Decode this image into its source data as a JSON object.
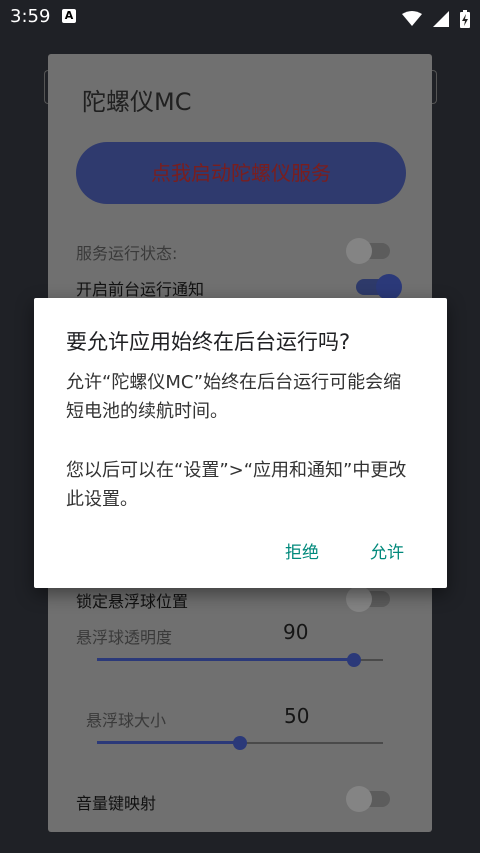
{
  "status_bar": {
    "time": "3:59",
    "notification_glyph": "A",
    "icons": [
      "wifi-icon",
      "signal-icon",
      "battery-charging-icon"
    ]
  },
  "app": {
    "title": "陀螺仪MC",
    "start_button": "点我启动陀螺仪服务",
    "service_status_label": "服务运行状态:",
    "service_status_on": false,
    "foreground_notify_label": "开启前台运行通知",
    "foreground_notify_on": true,
    "lock_float_label": "锁定悬浮球位置",
    "lock_float_on": false,
    "opacity_label": "悬浮球透明度",
    "opacity_value": "90",
    "opacity_fraction": 0.9,
    "size_label": "悬浮球大小",
    "size_value": "50",
    "size_fraction": 0.5,
    "volume_key_label": "音量键映射",
    "volume_key_on": false
  },
  "dialog": {
    "title": "要允许应用始终在后台运行吗?",
    "message1": "允许“陀螺仪MC”始终在后台运行可能会缩短电池的续航时间。",
    "message2": "您以后可以在“设置”>“应用和通知”中更改此设置。",
    "deny_label": "拒绝",
    "allow_label": "允许",
    "accent_color": "#00897b"
  }
}
